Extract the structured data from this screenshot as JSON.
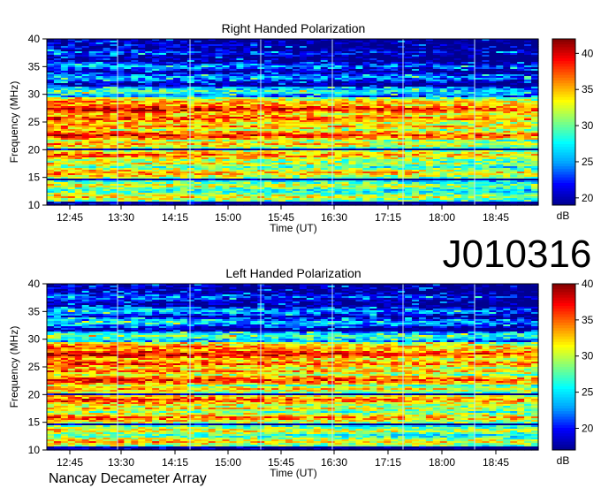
{
  "source_label": "Nancay Decameter Array",
  "observation_id": "J010316",
  "chart_data": [
    {
      "type": "heatmap",
      "title": "Right Handed Polarization",
      "xlabel": "Time (UT)",
      "ylabel": "Frequency (MHz)",
      "xticks": [
        "12:45",
        "13:30",
        "14:15",
        "15:00",
        "15:45",
        "16:30",
        "17:15",
        "18:00",
        "18:45"
      ],
      "yticks": [
        10,
        15,
        20,
        25,
        30,
        35,
        40
      ],
      "ylim": [
        10,
        40
      ],
      "colorbar": {
        "label": "dB",
        "ticks": [
          20,
          25,
          30,
          35,
          40
        ],
        "range": [
          19,
          42
        ]
      },
      "colormap": [
        "#00008f",
        "#0000ff",
        "#00a0ff",
        "#00ffff",
        "#80ff80",
        "#ffff00",
        "#ff8000",
        "#ff0000",
        "#800000"
      ],
      "bands": [
        {
          "f": 11.5,
          "v": 35
        },
        {
          "f": 13.5,
          "v": 34
        },
        {
          "f": 15.8,
          "v": 37
        },
        {
          "f": 17.5,
          "v": 34
        },
        {
          "f": 19.0,
          "v": 38
        },
        {
          "f": 21.0,
          "v": 36
        },
        {
          "f": 22.6,
          "v": 40
        },
        {
          "f": 24.2,
          "v": 37
        },
        {
          "f": 25.6,
          "v": 39
        },
        {
          "f": 27.3,
          "v": 41
        },
        {
          "f": 28.5,
          "v": 37
        },
        {
          "f": 30.5,
          "v": 30
        },
        {
          "f": 33.0,
          "v": 27
        },
        {
          "f": 35.0,
          "v": 26
        },
        {
          "f": 37.5,
          "v": 24
        }
      ]
    },
    {
      "type": "heatmap",
      "title": "Left Handed Polarization",
      "xlabel": "Time (UT)",
      "ylabel": "Frequency (MHz)",
      "xticks": [
        "12:45",
        "13:30",
        "14:15",
        "15:00",
        "15:45",
        "16:30",
        "17:15",
        "18:00",
        "18:45"
      ],
      "yticks": [
        10,
        15,
        20,
        25,
        30,
        35,
        40
      ],
      "ylim": [
        10,
        40
      ],
      "colorbar": {
        "label": "dB",
        "ticks": [
          20,
          25,
          30,
          35,
          40
        ],
        "range": [
          17,
          40
        ]
      },
      "colormap": [
        "#00008f",
        "#0000ff",
        "#00a0ff",
        "#00ffff",
        "#80ff80",
        "#ffff00",
        "#ff8000",
        "#ff0000",
        "#800000"
      ],
      "bands": [
        {
          "f": 11.5,
          "v": 34
        },
        {
          "f": 13.5,
          "v": 33
        },
        {
          "f": 15.8,
          "v": 36
        },
        {
          "f": 17.5,
          "v": 33
        },
        {
          "f": 19.0,
          "v": 37
        },
        {
          "f": 21.0,
          "v": 34
        },
        {
          "f": 22.6,
          "v": 38
        },
        {
          "f": 24.2,
          "v": 35
        },
        {
          "f": 25.6,
          "v": 37
        },
        {
          "f": 27.3,
          "v": 39
        },
        {
          "f": 28.5,
          "v": 36
        },
        {
          "f": 30.5,
          "v": 29
        },
        {
          "f": 33.0,
          "v": 26
        },
        {
          "f": 35.0,
          "v": 25
        },
        {
          "f": 37.5,
          "v": 23
        }
      ]
    }
  ]
}
